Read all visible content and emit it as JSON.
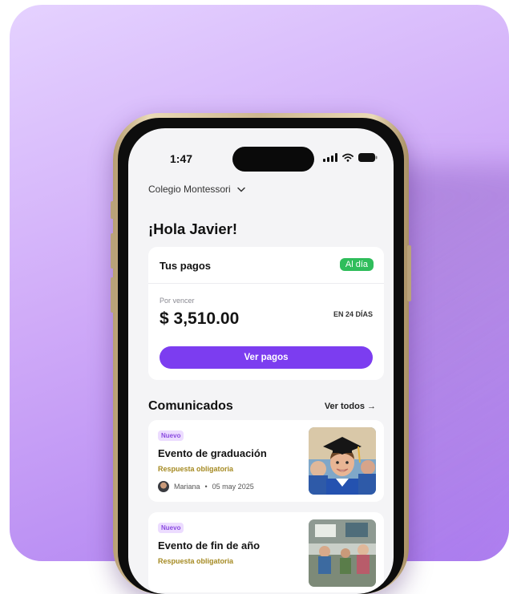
{
  "status_bar": {
    "time": "1:47"
  },
  "header": {
    "school_name": "Colegio Montessori",
    "greeting": "¡Hola Javier!"
  },
  "payments": {
    "title": "Tus pagos",
    "status_badge": "Al día",
    "due_label": "Por vencer",
    "amount": "$ 3,510.00",
    "due_in": "EN 24 DÍAS",
    "button_label": "Ver pagos"
  },
  "announcements": {
    "title": "Comunicados",
    "see_all_label": "Ver todos →",
    "items": [
      {
        "tag": "Nuevo",
        "title": "Evento de graduación",
        "requirement": "Respuesta obligatoria",
        "author": "Mariana",
        "date": "05 may 2025"
      },
      {
        "tag": "Nuevo",
        "title": "Evento de fin de año",
        "requirement": "Respuesta obligatoria"
      }
    ]
  },
  "colors": {
    "accent": "#7c3df0",
    "success": "#2fbd5b",
    "tag_bg": "#ecdcff",
    "warning_text": "#a58a22"
  }
}
